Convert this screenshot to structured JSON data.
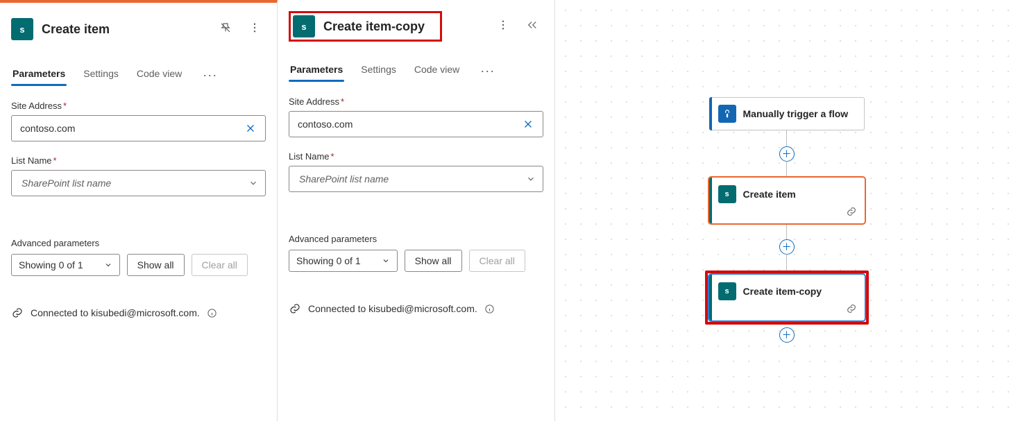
{
  "panelLeft": {
    "title": "Create item",
    "tabs": {
      "parameters": "Parameters",
      "settings": "Settings",
      "codeview": "Code view"
    },
    "siteAddress": {
      "label": "Site Address",
      "value": "contoso.com"
    },
    "listName": {
      "label": "List Name",
      "placeholder": "SharePoint list name"
    },
    "advanced": {
      "title": "Advanced parameters",
      "showing": "Showing 0 of 1",
      "showAll": "Show all",
      "clearAll": "Clear all"
    },
    "connection": "Connected to kisubedi@microsoft.com."
  },
  "panelMid": {
    "title": "Create item-copy",
    "tabs": {
      "parameters": "Parameters",
      "settings": "Settings",
      "codeview": "Code view"
    },
    "siteAddress": {
      "label": "Site Address",
      "value": "contoso.com"
    },
    "listName": {
      "label": "List Name",
      "placeholder": "SharePoint list name"
    },
    "advanced": {
      "title": "Advanced parameters",
      "showing": "Showing 0 of 1",
      "showAll": "Show all",
      "clearAll": "Clear all"
    },
    "connection": "Connected to kisubedi@microsoft.com."
  },
  "flow": {
    "trigger": "Manually trigger a flow",
    "action1": "Create item",
    "action2": "Create item-copy"
  }
}
